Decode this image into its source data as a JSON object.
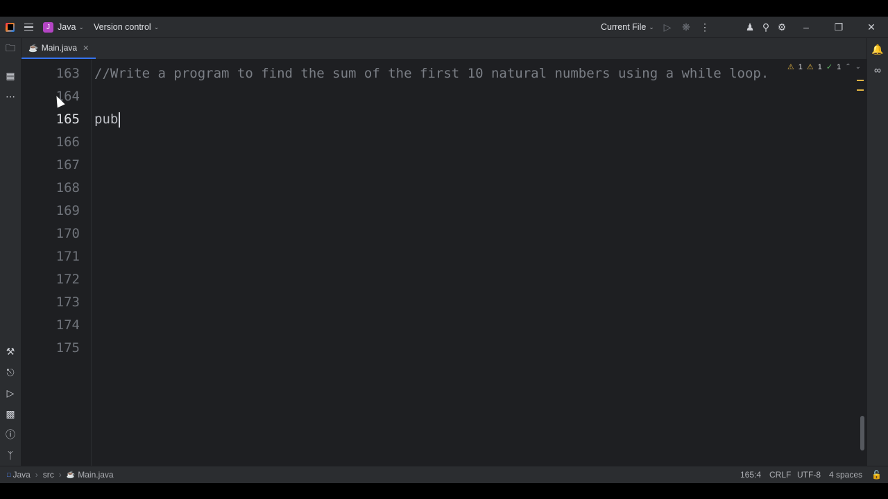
{
  "titlebar": {
    "project_badge": "J",
    "project_name": "Java",
    "vcs_label": "Version control",
    "run_config": "Current File"
  },
  "tabs": [
    {
      "label": "Main.java"
    }
  ],
  "editor": {
    "line_numbers": [
      "163",
      "164",
      "165",
      "166",
      "167",
      "168",
      "169",
      "170",
      "171",
      "172",
      "173",
      "174",
      "175"
    ],
    "current_line_number": "165",
    "comment_line": "//Write a program to find the sum of the first 10 natural numbers using a while loop.",
    "typed_line": "pub",
    "inspections": {
      "warnings_a": "1",
      "warnings_b": "1",
      "ok_count": "1"
    }
  },
  "statusbar": {
    "breadcrumb": [
      "Java",
      "src",
      "Main.java"
    ],
    "caret_position": "165:4",
    "line_separator": "CRLF",
    "encoding": "UTF-8",
    "indent": "4 spaces"
  },
  "colors": {
    "accent": "#3574f0",
    "editor_bg": "#1e1f22",
    "panel_bg": "#2b2d30",
    "comment": "#7a7e85",
    "warning": "#e0b343"
  }
}
